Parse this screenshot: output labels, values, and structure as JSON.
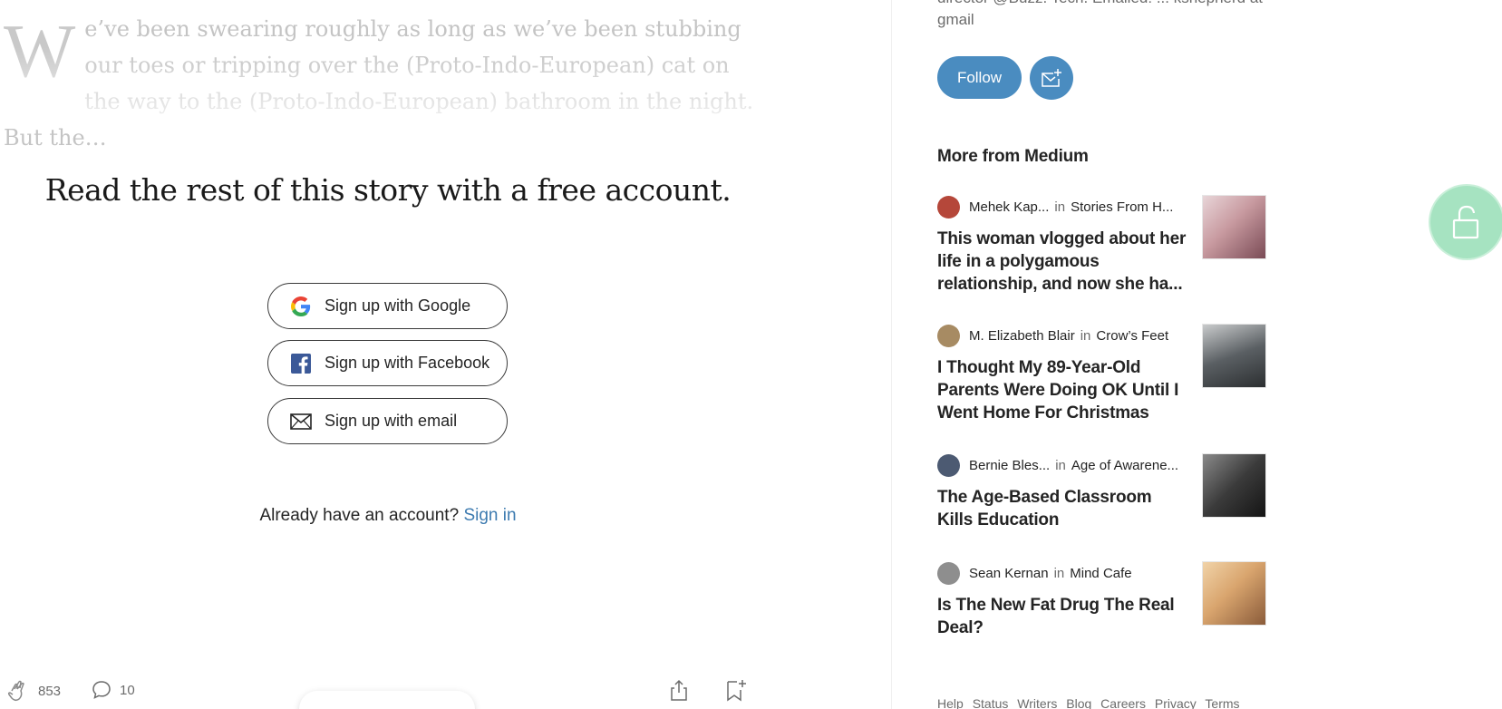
{
  "excerpt": {
    "dropcap": "W",
    "text": "e’ve been swearing roughly as long as we’ve been stubbing our toes or tripping over the (Proto-Indo-European) cat on the way to the (Proto-Indo-European) bathroom in the night. But the…"
  },
  "paywall": {
    "title": "Read the rest of this story with a free account.",
    "google_label": "Sign up with Google",
    "facebook_label": "Sign up with Facebook",
    "email_label": "Sign up with email",
    "already_text": "Already have an account?",
    "signin_label": "Sign in"
  },
  "actions": {
    "claps": "853",
    "comments": "10"
  },
  "sidebar": {
    "bio_tail": "director @Buzz. Tech. Emailed: ... kshepherd at gmail",
    "follow_label": "Follow",
    "more_title": "More from Medium",
    "stories": [
      {
        "author": "Mehek Kap...",
        "in": "in",
        "publication": "Stories From H...",
        "title": "This woman vlogged about her life in a polygamous relationship, and now she ha...",
        "avatar_color": "#b5473a",
        "thumb_color": "#c89aa0"
      },
      {
        "author": "M. Elizabeth Blair",
        "in": "in",
        "publication": "Crow’s Feet",
        "title": "I Thought My 89-Year-Old Parents Were Doing OK Until I Went Home For Christmas",
        "avatar_color": "#a78b63",
        "thumb_color": "#5a5f63"
      },
      {
        "author": "Bernie Bles...",
        "in": "in",
        "publication": "Age of Awarene...",
        "title": "The Age-Based Classroom Kills Education",
        "avatar_color": "#4c5a72",
        "thumb_color": "#3b3b3b"
      },
      {
        "author": "Sean Kernan",
        "in": "in",
        "publication": "Mind Cafe",
        "title": "Is The New Fat Drug The Real Deal?",
        "avatar_color": "#8e8e8e",
        "thumb_color": "#d9a56e"
      }
    ],
    "footer": [
      "Help",
      "Status",
      "Writers",
      "Blog",
      "Careers",
      "Privacy",
      "Terms"
    ]
  },
  "colors": {
    "accent": "#4a8cc0",
    "link": "#3d7bb0",
    "unlock_fab": "#a6e3c1"
  },
  "icons": {
    "google": "google-icon",
    "facebook": "facebook-icon",
    "email": "mail-icon",
    "clap": "clap-icon",
    "comment": "comment-icon",
    "share": "share-icon",
    "bookmark": "bookmark-add-icon",
    "subscribe": "mail-plus-icon",
    "unlock": "unlock-icon"
  }
}
